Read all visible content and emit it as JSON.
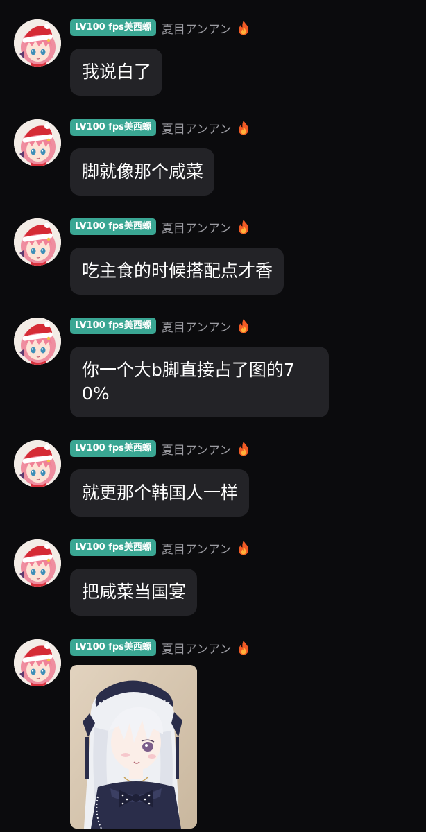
{
  "messages": [
    {
      "badge": "LV100 fps美西螈",
      "username": "夏目アンアン",
      "text": "我说白了"
    },
    {
      "badge": "LV100 fps美西螈",
      "username": "夏目アンアン",
      "text": "脚就像那个咸菜"
    },
    {
      "badge": "LV100 fps美西螈",
      "username": "夏目アンアン",
      "text": "吃主食的时候搭配点才香"
    },
    {
      "badge": "LV100 fps美西螈",
      "username": "夏目アンアン",
      "text": "你一个大b脚直接占了图的70%"
    },
    {
      "badge": "LV100 fps美西螈",
      "username": "夏目アンアン",
      "text": "就更那个韩国人一样"
    },
    {
      "badge": "LV100 fps美西螈",
      "username": "夏目アンアン",
      "text": "把咸菜当国宴"
    },
    {
      "badge": "LV100 fps美西螈",
      "username": "夏目アンアン",
      "image": "anime-girl-gothic-lolita-sticker"
    }
  ],
  "icons": {
    "fire": "fire-icon",
    "avatar": "anime-girl-santa-hat-avatar"
  },
  "colors": {
    "background": "#0b0b0d",
    "bubble": "#232327",
    "badge": "#3aa693",
    "username": "#9c9ca2",
    "text": "#ffffff"
  }
}
